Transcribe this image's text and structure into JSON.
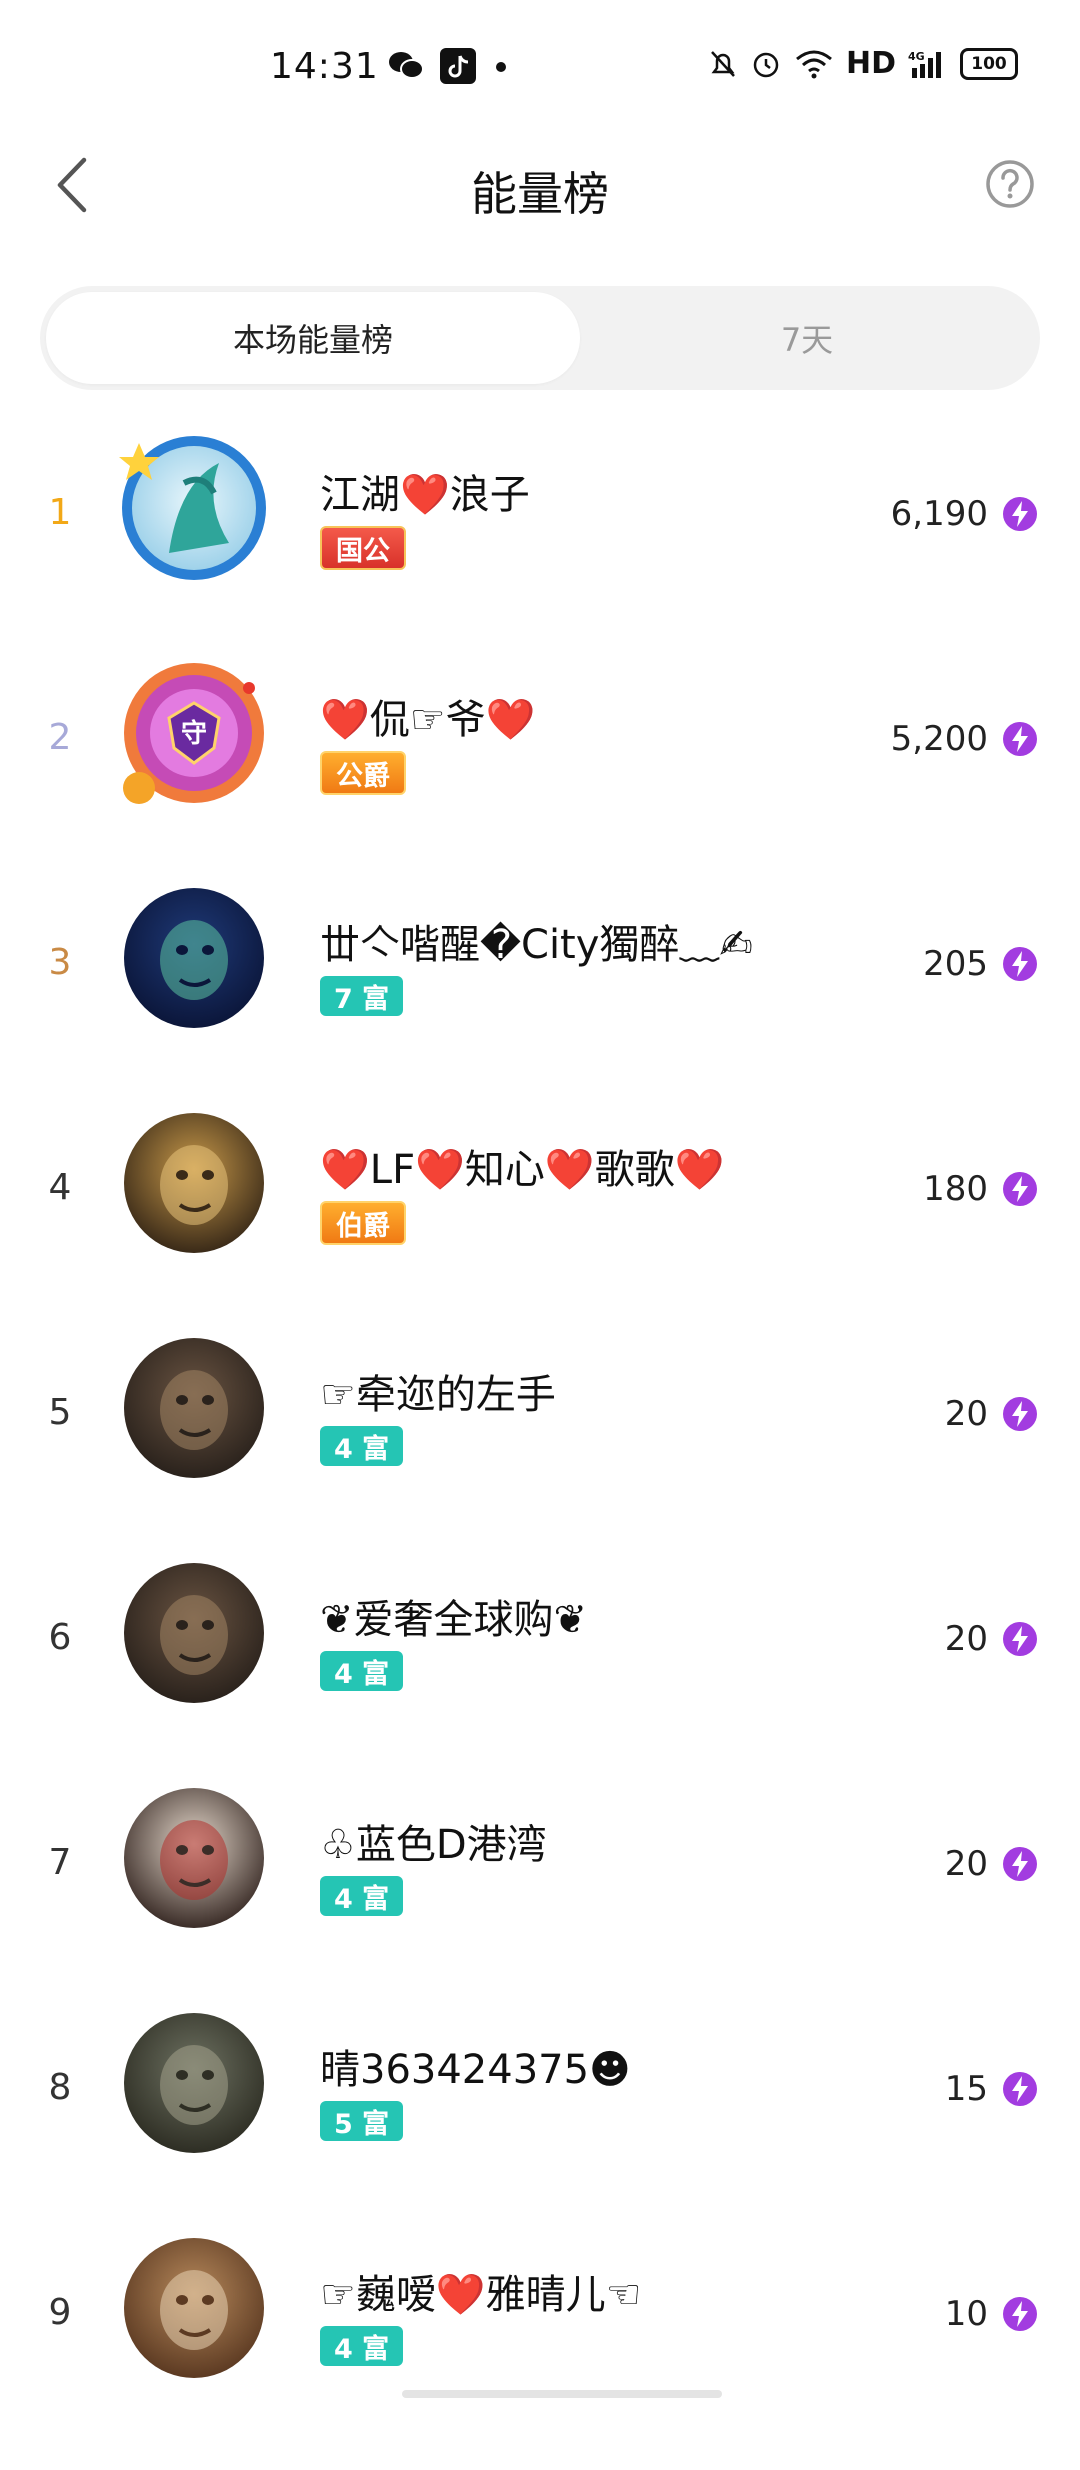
{
  "status": {
    "time": "14:31",
    "hd": "HD",
    "network": "4G",
    "battery": "100"
  },
  "header": {
    "title": "能量榜"
  },
  "tabs": [
    {
      "label": "本场能量榜",
      "active": true
    },
    {
      "label": "7天",
      "active": false
    }
  ],
  "rows": [
    {
      "rank": "1",
      "name": "江湖❤️浪子",
      "badge": "国公",
      "badge_style": "red",
      "score": "6,190",
      "rank_color": "#f2a817"
    },
    {
      "rank": "2",
      "name": "❤️侃☞爷❤️",
      "badge": "公爵",
      "badge_style": "orange",
      "score": "5,200",
      "rank_color": "#a7a9d8"
    },
    {
      "rank": "3",
      "name": "丗亽喈醒�City獨醉﹏✍",
      "badge": "7 富",
      "badge_style": "teal",
      "score": "205",
      "rank_color": "#c98a45"
    },
    {
      "rank": "4",
      "name": "❤️LF❤️知心❤️歌歌❤️",
      "badge": "伯爵",
      "badge_style": "orange",
      "score": "180",
      "rank_color": "#333333"
    },
    {
      "rank": "5",
      "name": "☞牵迩的左手",
      "badge": "4 富",
      "badge_style": "teal",
      "score": "20",
      "rank_color": "#333333"
    },
    {
      "rank": "6",
      "name": "❦爱奢全球购❦",
      "badge": "4 富",
      "badge_style": "teal",
      "score": "20",
      "rank_color": "#333333"
    },
    {
      "rank": "7",
      "name": "♧蓝色D港湾",
      "badge": "4 富",
      "badge_style": "teal",
      "score": "20",
      "rank_color": "#333333"
    },
    {
      "rank": "8",
      "name": "晴363424375☻",
      "badge": "5 富",
      "badge_style": "teal",
      "score": "15",
      "rank_color": "#333333"
    },
    {
      "rank": "9",
      "name": "☞巍嗳❤️雅晴儿☜",
      "badge": "4 富",
      "badge_style": "teal",
      "score": "10",
      "rank_color": "#333333"
    }
  ],
  "icons": {
    "energy": "energy-bolt-icon",
    "back": "chevron-left-icon",
    "help": "question-circle-icon"
  },
  "colors": {
    "energy_purple": "#a23ce0",
    "badge_teal": "#25c5b4"
  }
}
